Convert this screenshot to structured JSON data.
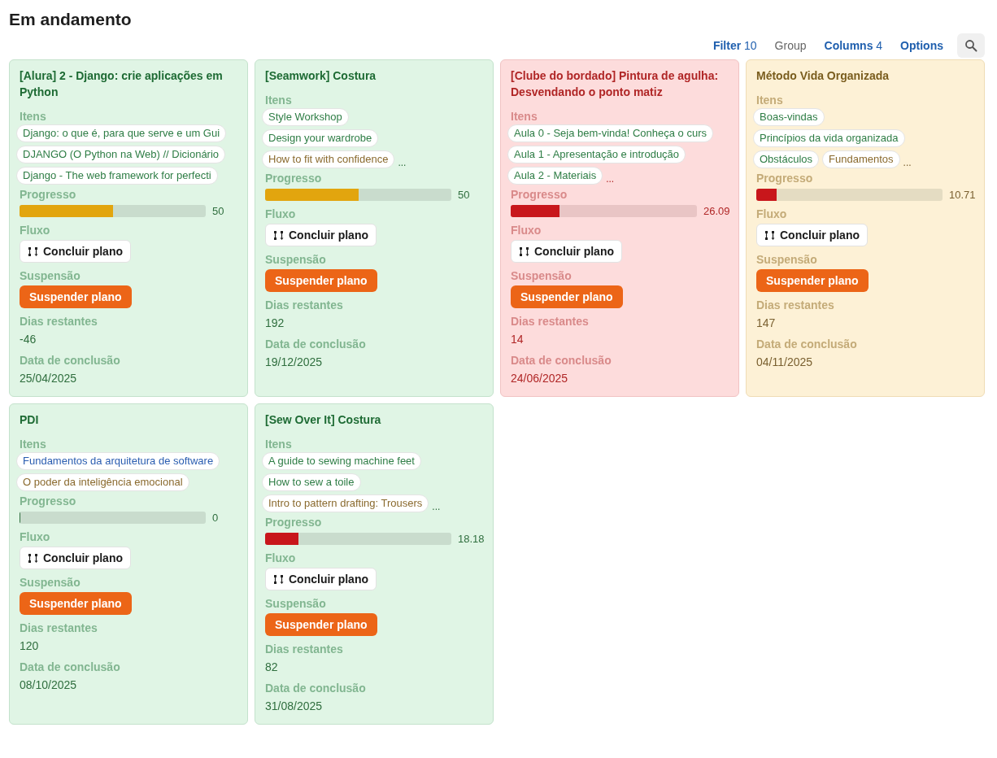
{
  "title": "Em andamento",
  "toolbar": [
    {
      "kind": "count",
      "label": "Filter",
      "count": "10",
      "disabled": false
    },
    {
      "kind": "plain",
      "label": "Group",
      "disabled": true
    },
    {
      "kind": "count",
      "label": "Columns",
      "count": "4",
      "disabled": false
    },
    {
      "kind": "plain",
      "label": "Options",
      "disabled": false
    }
  ],
  "cards": [
    {
      "title": "[Alura] 2 - Django: crie aplicações em Python",
      "color": "#1e6b34",
      "items_label": "Itens",
      "item_rows": [
        [
          {
            "text": "Django: o que é, para que serve e um Gui",
            "color": "#2e7d45"
          }
        ],
        [
          {
            "text": "DJANGO (O Python na Web) // Dicionário",
            "color": "#2e7d45"
          }
        ],
        [
          {
            "text": "Django - The web framework for perfecti",
            "color": "#2e7d45"
          }
        ]
      ],
      "progress_label": "Progresso",
      "progress": {
        "level": 0.5,
        "reading": "50",
        "color": "#e2a50e"
      },
      "flow_label": "Fluxo",
      "flow_button": "Concluir plano",
      "suspension_label": "Suspensão",
      "suspension_button": "Suspender plano",
      "days_label": "Dias restantes",
      "days": "-46",
      "date_label": "Data de conclusão",
      "date": "25/04/2025"
    },
    {
      "title": "[Seamwork] Costura",
      "color": "#1e6b34",
      "items_label": "Itens",
      "item_rows": [
        [
          {
            "text": "Style Workshop",
            "color": "#2e7d45"
          }
        ],
        [
          {
            "text": "Design your wardrobe",
            "color": "#2e7d45"
          }
        ],
        [
          {
            "text": "How to fit with confidence",
            "color": "#8a6a2e"
          }
        ]
      ],
      "more": "...",
      "progress_label": "Progresso",
      "progress": {
        "level": 0.5,
        "reading": "50",
        "color": "#e2a50e"
      },
      "flow_label": "Fluxo",
      "flow_button": "Concluir plano",
      "suspension_label": "Suspensão",
      "suspension_button": "Suspender plano",
      "days_label": "Dias restantes",
      "days": "192",
      "date_label": "Data de conclusão",
      "date": "19/12/2025"
    },
    {
      "title": "[Clube do bordado] Pintura de agulha: Desvendando o ponto matiz",
      "color": "#b02626",
      "items_label": "Itens",
      "item_rows": [
        [
          {
            "text": "Aula 0 - Seja bem-vinda! Conheça o curs",
            "color": "#2e7d45"
          }
        ],
        [
          {
            "text": "Aula 1 - Apresentação e introdução",
            "color": "#2e7d45"
          }
        ],
        [
          {
            "text": "Aula 2 - Materiais",
            "color": "#2e7d45"
          }
        ]
      ],
      "more": "...",
      "progress_label": "Progresso",
      "progress": {
        "level": 0.26,
        "reading": "26.09",
        "color": "#c8161b"
      },
      "flow_label": "Fluxo",
      "flow_button": "Concluir plano",
      "suspension_label": "Suspensão",
      "suspension_button": "Suspender plano",
      "days_label": "Dias restantes",
      "days": "14",
      "date_label": "Data de conclusão",
      "date": "24/06/2025"
    },
    {
      "title": "Método Vida Organizada",
      "color": "#7a5d1e",
      "items_label": "Itens",
      "item_rows": [
        [
          {
            "text": "Boas-vindas",
            "color": "#2e7d45"
          }
        ],
        [
          {
            "text": "Princípios da vida organizada",
            "color": "#2e7d45"
          }
        ],
        [
          {
            "text": "Obstáculos",
            "color": "#2e7d45"
          },
          {
            "text": "Fundamentos",
            "color": "#8a6a2e"
          }
        ]
      ],
      "more": "...",
      "progress_label": "Progresso",
      "progress": {
        "level": 0.107,
        "reading": "10.71",
        "color": "#c8161b"
      },
      "flow_label": "Fluxo",
      "flow_button": "Concluir plano",
      "suspension_label": "Suspensão",
      "suspension_button": "Suspender plano",
      "days_label": "Dias restantes",
      "days": "147",
      "date_label": "Data de conclusão",
      "date": "04/11/2025"
    },
    {
      "title": "PDI",
      "color": "#1e6b34",
      "items_label": "Itens",
      "item_rows": [
        [
          {
            "text": "Fundamentos da arquitetura de software",
            "color": "#2a5db0"
          }
        ],
        [
          {
            "text": "O poder da inteligência emocional",
            "color": "#8a6a2e"
          }
        ]
      ],
      "progress_label": "Progresso",
      "progress": {
        "level": 0,
        "reading": "0"
      },
      "flow_label": "Fluxo",
      "flow_button": "Concluir plano",
      "suspension_label": "Suspensão",
      "suspension_button": "Suspender plano",
      "days_label": "Dias restantes",
      "days": "120",
      "date_label": "Data de conclusão",
      "date": "08/10/2025"
    },
    {
      "title": "[Sew Over It] Costura",
      "color": "#1e6b34",
      "items_label": "Itens",
      "item_rows": [
        [
          {
            "text": "A guide to sewing machine feet",
            "color": "#2e7d45"
          }
        ],
        [
          {
            "text": "How to sew a toile",
            "color": "#2e7d45"
          }
        ],
        [
          {
            "text": "Intro to pattern drafting: Trousers",
            "color": "#8a6a2e"
          }
        ]
      ],
      "more": "...",
      "progress_label": "Progresso",
      "progress": {
        "level": 0.18,
        "reading": "18.18",
        "color": "#c8161b"
      },
      "flow_label": "Fluxo",
      "flow_button": "Concluir plano",
      "suspension_label": "Suspensão",
      "suspension_button": "Suspender plano",
      "days_label": "Dias restantes",
      "days": "82",
      "date_label": "Data de conclusão",
      "date": "31/08/2025"
    }
  ]
}
